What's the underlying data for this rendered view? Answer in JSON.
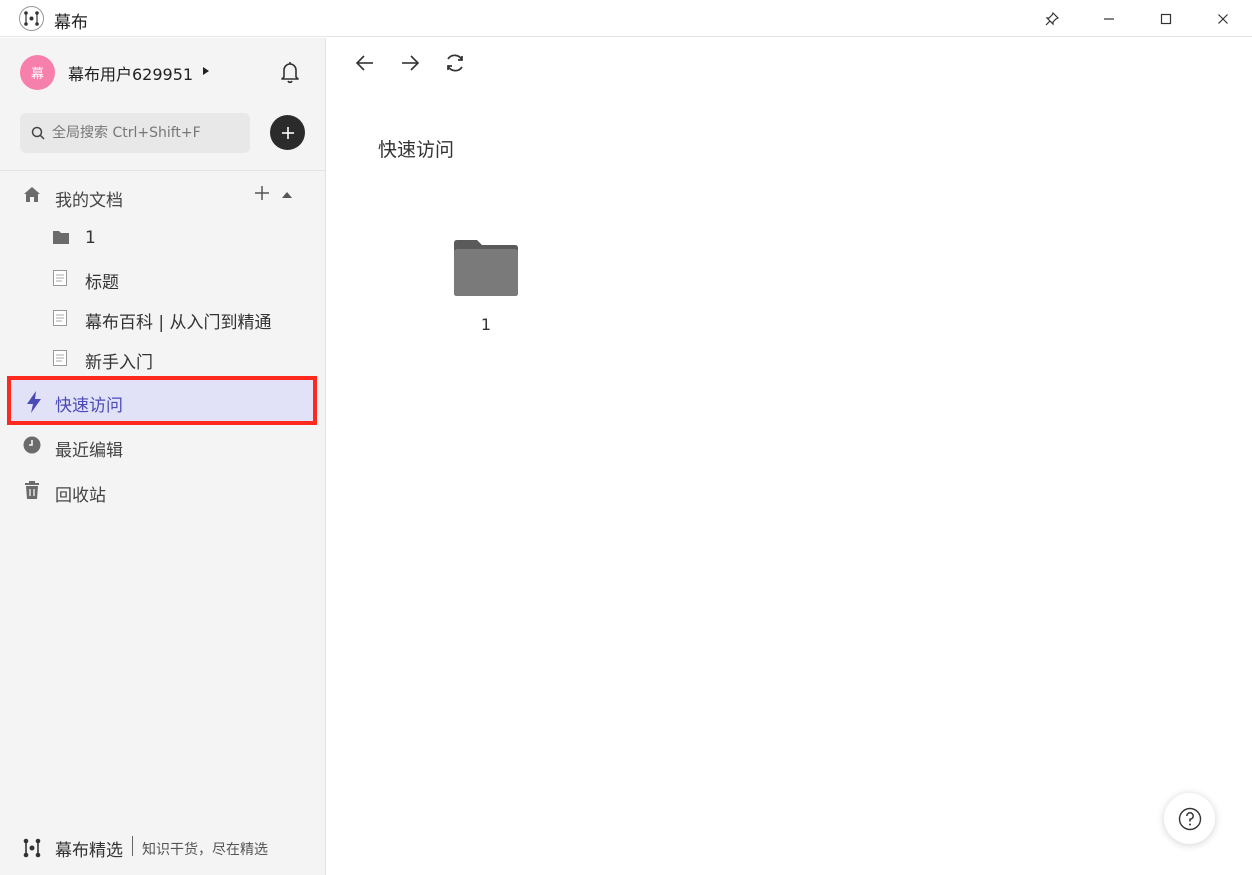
{
  "window": {
    "title": "幕布",
    "controls": [
      "pin-icon",
      "minimize-icon",
      "maximize-icon",
      "close-icon"
    ]
  },
  "sidebar": {
    "avatar_text": "幕",
    "avatar_color": "#f77fac",
    "username": "幕布用户629951",
    "search": {
      "placeholder": "全局搜索 Ctrl+Shift+F"
    },
    "my_docs": {
      "label": "我的文档",
      "items": [
        {
          "label": "1",
          "icon": "folder-icon"
        },
        {
          "label": "标题",
          "icon": "document-icon"
        },
        {
          "label": "幕布百科 | 从入门到精通",
          "icon": "document-icon"
        },
        {
          "label": "新手入门",
          "icon": "document-icon"
        }
      ]
    },
    "nav": {
      "quick_access": "快速访问",
      "recent_edits": "最近编辑",
      "trash": "回收站"
    },
    "footer": {
      "brand": "幕布精选",
      "slogan": "知识干货，尽在精选"
    },
    "highlight_color": "#ff2a1f",
    "active_bg": "#e1e1f7"
  },
  "main": {
    "title": "快速访问",
    "items": [
      {
        "label": "1",
        "icon": "folder-icon"
      }
    ]
  }
}
